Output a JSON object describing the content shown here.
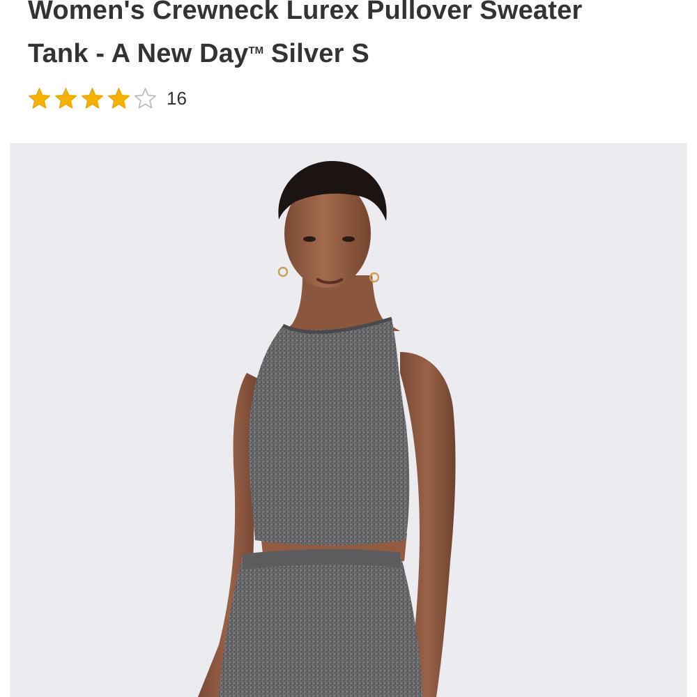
{
  "product": {
    "title_line1": "Women's Crewneck Lurex Pullover Sweater",
    "title_line2_main": "Tank - A New Day",
    "title_tm": "TM",
    "title_line2_end": " Silver S"
  },
  "rating": {
    "value": 4,
    "max": 5,
    "review_count": "16",
    "star_color": "#f5b301",
    "star_outline_color": "#f0a500",
    "empty_star_color": "#b8b8b8"
  },
  "image": {
    "background_color": "#ecebf0",
    "icon": "product-photo"
  }
}
